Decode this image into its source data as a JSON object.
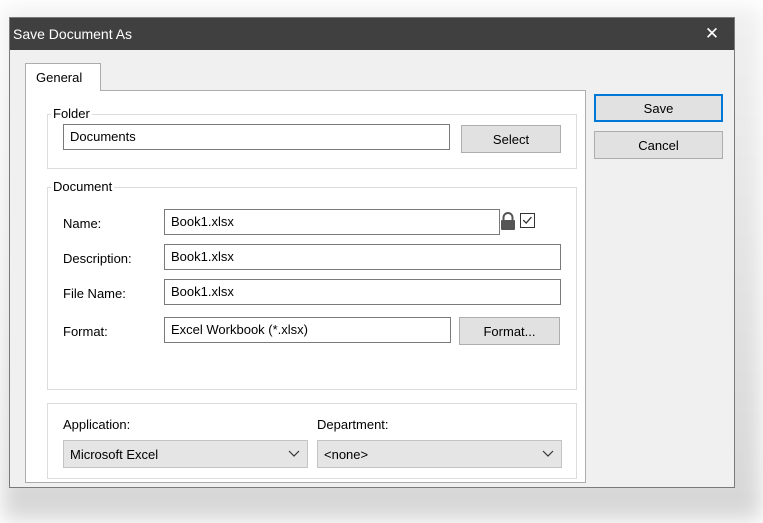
{
  "window": {
    "title": "Save Document As",
    "close_glyph": "✕"
  },
  "tabs": [
    {
      "label": "General"
    }
  ],
  "folder": {
    "group_label": "Folder",
    "value": "Documents",
    "select_label": "Select"
  },
  "document": {
    "group_label": "Document",
    "name_label": "Name:",
    "name_value": "Book1.xlsx",
    "description_label": "Description:",
    "description_value": "Book1.xlsx",
    "filename_label": "File Name:",
    "filename_value": "Book1.xlsx",
    "format_label": "Format:",
    "format_value": "Excel Workbook (*.xlsx)",
    "format_button_label": "Format...",
    "lock_icon": "lock-icon",
    "checkbox_checked": true
  },
  "classification": {
    "application_label": "Application:",
    "application_value": "Microsoft Excel",
    "department_label": "Department:",
    "department_value": "<none>"
  },
  "actions": {
    "save_label": "Save",
    "cancel_label": "Cancel"
  },
  "colors": {
    "titlebar": "#404040",
    "default_button_border": "#0078d7"
  }
}
